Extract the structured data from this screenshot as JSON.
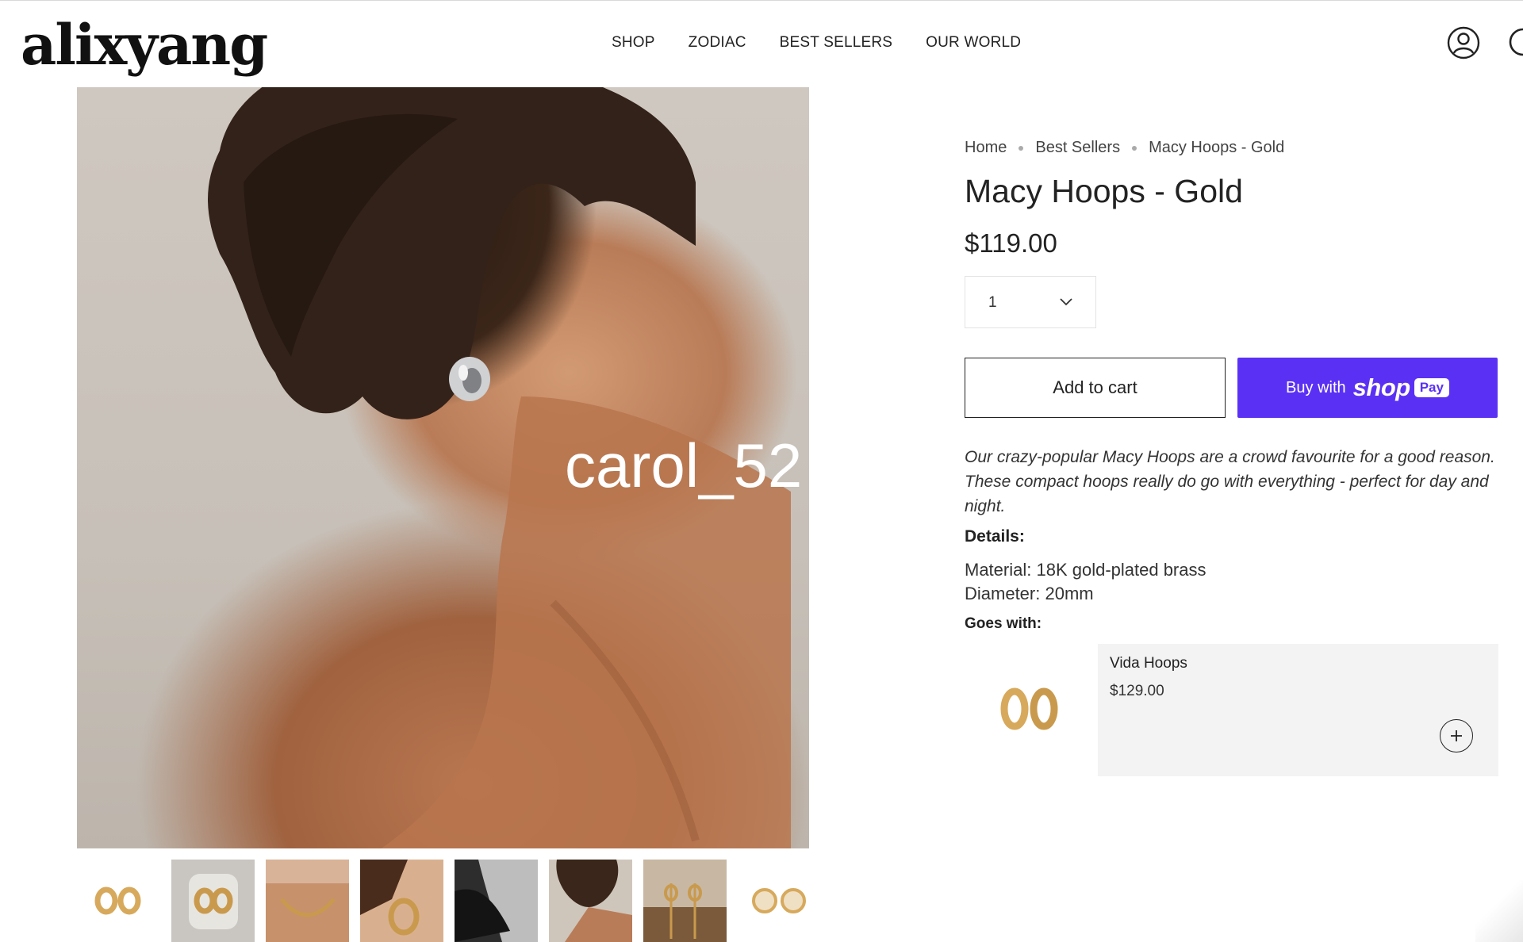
{
  "header": {
    "logo": "alixyang",
    "nav": [
      "SHOP",
      "ZODIAC",
      "BEST SELLERS",
      "OUR WORLD"
    ],
    "icons": [
      "account-icon",
      "search-icon"
    ]
  },
  "gallery": {
    "watermark": "carol_52",
    "thumbnail_count": 8
  },
  "product": {
    "breadcrumb": [
      "Home",
      "Best Sellers",
      "Macy Hoops - Gold"
    ],
    "title": "Macy Hoops - Gold",
    "price": "$119.00",
    "quantity": "1",
    "add_to_cart": "Add to cart",
    "buy_with": "Buy with",
    "shop_pay": "shop",
    "pay_badge": "Pay",
    "description": "Our crazy-popular Macy Hoops are a crowd favourite for a good reason. These compact hoops really do go with everything - perfect for day and night.",
    "details_label": "Details:",
    "details": [
      "Material: 18K gold-plated brass",
      "Diameter: 20mm"
    ],
    "goes_with_label": "Goes with:"
  },
  "recommendation": {
    "name": "Vida Hoops",
    "price": "$129.00",
    "add_icon": "plus-icon"
  },
  "colors": {
    "shop_pay": "#5a31f4",
    "card_bg": "#f3f3f3",
    "gold": "#d7a95c"
  }
}
